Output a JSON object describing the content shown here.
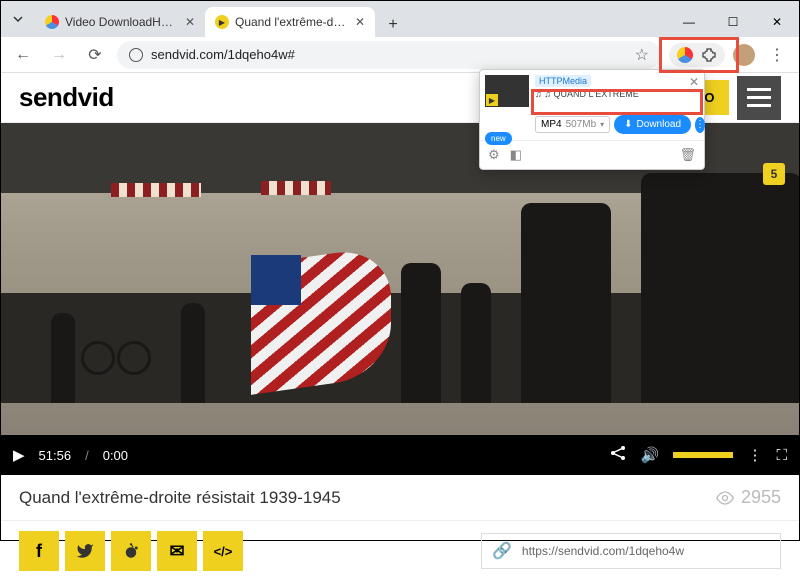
{
  "browser": {
    "tabs": [
      {
        "title": "Video DownloadHelper - Chro",
        "active": false
      },
      {
        "title": "Quand l'extrême-droite résista",
        "active": true
      }
    ],
    "url": "sendvid.com/1dqeho4w#"
  },
  "site": {
    "logo": "sendvid",
    "upload_label": "UPLOAD VIDEO"
  },
  "video": {
    "watermark": "5",
    "current_time": "51:56",
    "separator": "/",
    "duration": "0:00"
  },
  "meta": {
    "title": "Quand l'extrême-droite résistait 1939-1945",
    "views": "2955"
  },
  "share": {
    "facebook": "f",
    "twitter": "🐦",
    "reddit": "👽",
    "email": "✉",
    "embed": "</>",
    "url": "https://sendvid.com/1dqeho4w"
  },
  "ext": {
    "badge": "HTTPMedia",
    "item_title": "♫ ♫  QUAND L'EXTRÊME",
    "format": "MP4",
    "size": "507Mb",
    "download_label": "Download",
    "new_label": "new"
  }
}
